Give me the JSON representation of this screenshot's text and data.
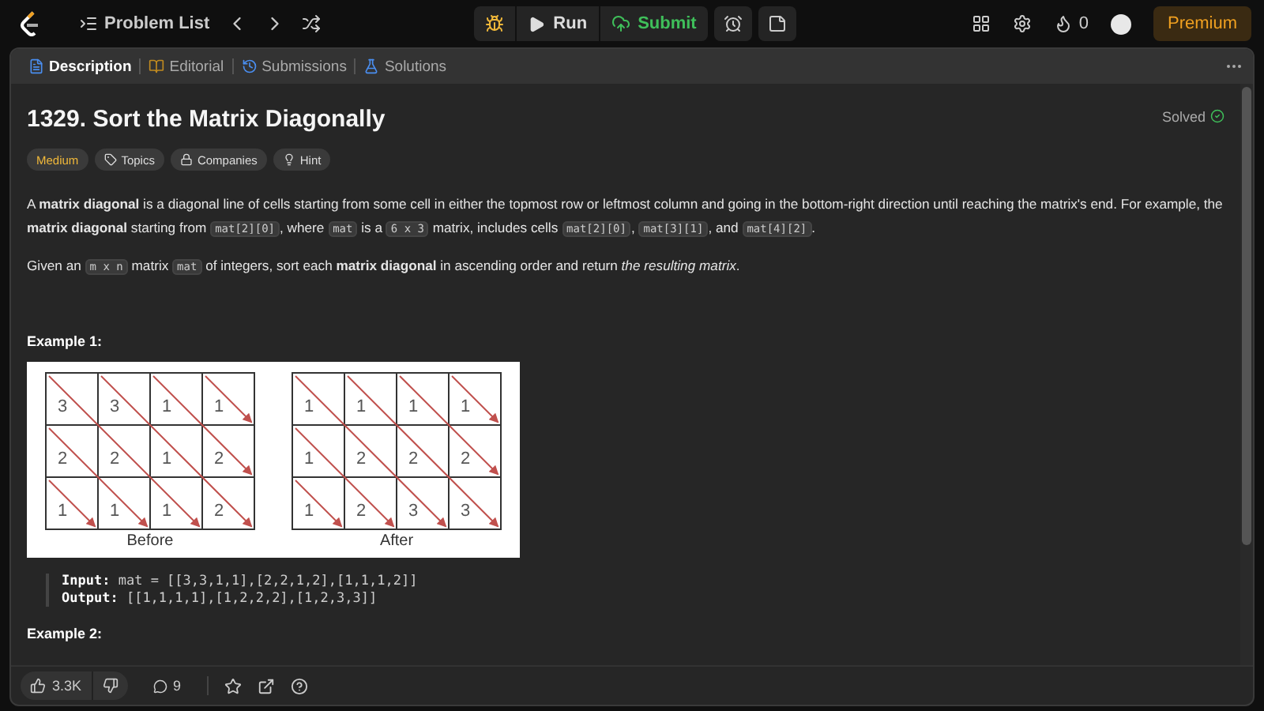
{
  "topbar": {
    "nav_label": "Problem List",
    "run": "Run",
    "submit": "Submit",
    "streak": "0",
    "premium": "Premium"
  },
  "tabs": [
    {
      "label": "Description",
      "selected": true,
      "kind": "description"
    },
    {
      "label": "Editorial",
      "selected": false,
      "kind": "editorial"
    },
    {
      "label": "Submissions",
      "selected": false,
      "kind": "submissions"
    },
    {
      "label": "Solutions",
      "selected": false,
      "kind": "solutions"
    }
  ],
  "problem": {
    "title": "1329. Sort the Matrix Diagonally",
    "status": "Solved",
    "difficulty": "Medium",
    "tags": [
      {
        "label": "Topics",
        "kind": "topics"
      },
      {
        "label": "Companies",
        "kind": "companies"
      },
      {
        "label": "Hint",
        "kind": "hint"
      }
    ],
    "paragraphs": [
      [
        {
          "kind": "text",
          "text": "A **matrix diagonal** is a diagonal line of cells starting from some cell in either the topmost row or leftmost column and going in the bottom-right direction until reaching the matrix's end. For example, the **matrix diagonal** starting from "
        },
        {
          "kind": "code",
          "text": "mat[2][0]"
        },
        {
          "kind": "text",
          "text": ", where "
        },
        {
          "kind": "code",
          "text": "mat"
        },
        {
          "kind": "text",
          "text": " is a "
        },
        {
          "kind": "code",
          "text": "6 x 3"
        },
        {
          "kind": "text",
          "text": " matrix, includes cells "
        },
        {
          "kind": "code",
          "text": "mat[2][0]"
        },
        {
          "kind": "text",
          "text": ", "
        },
        {
          "kind": "code",
          "text": "mat[3][1]"
        },
        {
          "kind": "text",
          "text": ", and "
        },
        {
          "kind": "code",
          "text": "mat[4][2]"
        },
        {
          "kind": "text",
          "text": "."
        }
      ],
      [
        {
          "kind": "text",
          "text": "Given an "
        },
        {
          "kind": "code",
          "text": "m x n"
        },
        {
          "kind": "text",
          "text": " matrix "
        },
        {
          "kind": "code",
          "text": "mat"
        },
        {
          "kind": "text",
          "text": " of integers, sort each **matrix diagonal** in ascending order and return *the resulting matrix*."
        }
      ]
    ],
    "examples": [
      {
        "heading": "Example 1:",
        "figure": [
          {
            "caption": "Before",
            "rows": [
              [
                "3",
                "3",
                "1",
                "1"
              ],
              [
                "2",
                "2",
                "1",
                "2"
              ],
              [
                "1",
                "1",
                "1",
                "2"
              ]
            ]
          },
          {
            "caption": "After",
            "rows": [
              [
                "1",
                "1",
                "1",
                "1"
              ],
              [
                "1",
                "2",
                "2",
                "2"
              ],
              [
                "1",
                "2",
                "3",
                "3"
              ]
            ]
          }
        ],
        "lines": [
          {
            "label": "Input:",
            "value": "mat = [[3,3,1,1],[2,2,1,2],[1,1,1,2]]"
          },
          {
            "label": "Output:",
            "value": "[[1,1,1,1],[1,2,2,2],[1,2,3,3]]"
          }
        ]
      },
      {
        "heading": "Example 2:"
      }
    ]
  },
  "footer": {
    "likes": "3.3K",
    "comments": "9"
  }
}
